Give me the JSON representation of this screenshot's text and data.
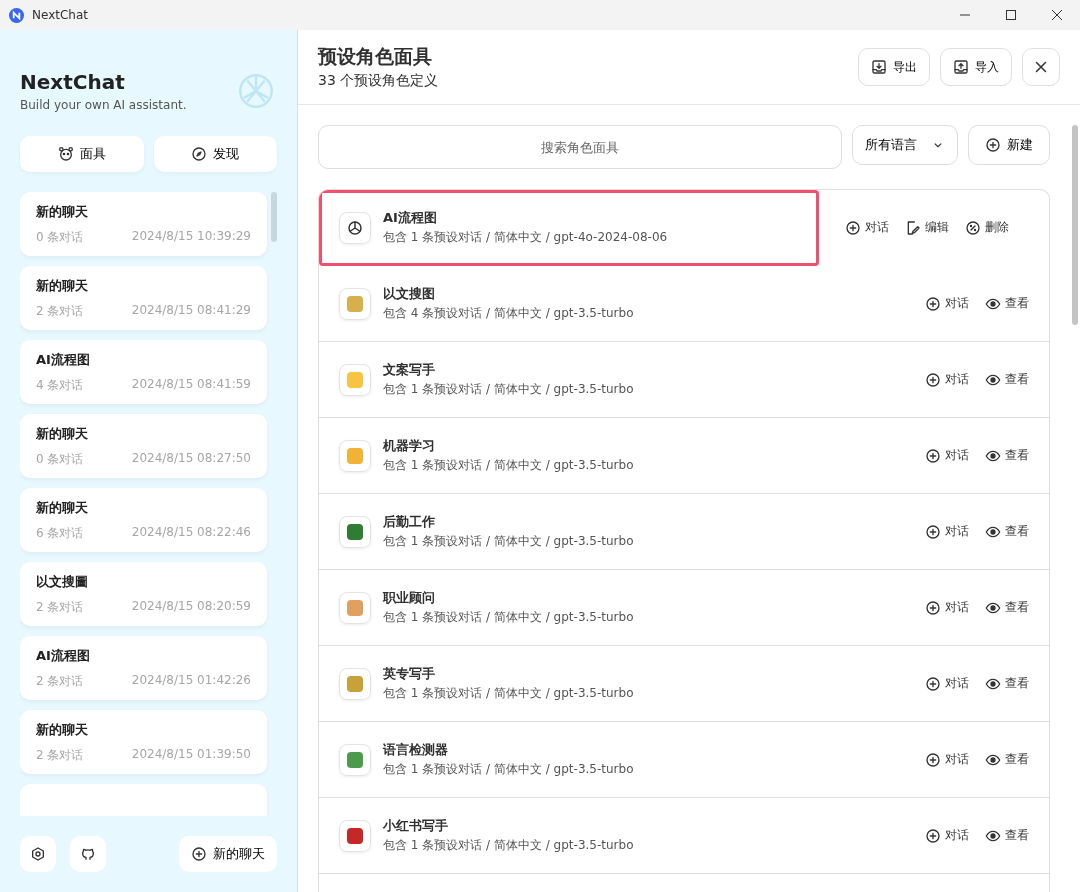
{
  "window": {
    "title": "NextChat"
  },
  "sidebar": {
    "title": "NextChat",
    "subtitle": "Build your own AI assistant.",
    "nav_buttons": [
      {
        "kind": "mask",
        "label": "面具"
      },
      {
        "kind": "discover",
        "label": "发现"
      }
    ],
    "chats": [
      {
        "title": "新的聊天",
        "count": "0 条对话",
        "time": "2024/8/15 10:39:29"
      },
      {
        "title": "新的聊天",
        "count": "2 条对话",
        "time": "2024/8/15 08:41:29"
      },
      {
        "title": "AI流程图",
        "count": "4 条对话",
        "time": "2024/8/15 08:41:59"
      },
      {
        "title": "新的聊天",
        "count": "0 条对话",
        "time": "2024/8/15 08:27:50"
      },
      {
        "title": "新的聊天",
        "count": "6 条对话",
        "time": "2024/8/15 08:22:46"
      },
      {
        "title": "以文搜圖",
        "count": "2 条对话",
        "time": "2024/8/15 08:20:59"
      },
      {
        "title": "AI流程图",
        "count": "2 条对话",
        "time": "2024/8/15 01:42:26"
      },
      {
        "title": "新的聊天",
        "count": "2 条对话",
        "time": "2024/8/15 01:39:50"
      }
    ],
    "new_chat": "新的聊天"
  },
  "header": {
    "title": "预设角色面具",
    "subtitle": "33 个预设角色定义",
    "actions": [
      {
        "kind": "export",
        "label": "导出"
      },
      {
        "kind": "import",
        "label": "导入"
      }
    ]
  },
  "toolbar": {
    "search": {
      "placeholder": "搜索角色面具"
    },
    "language": "所有语言",
    "new_button": "新建"
  },
  "masks": [
    {
      "name": "AI流程图",
      "info": "包含 1 条预设对话 / 简体中文 / gpt-4o-2024-08-06",
      "highlighted": true,
      "actions": [
        {
          "kind": "chat",
          "label": "对话"
        },
        {
          "kind": "edit",
          "label": "编辑"
        },
        {
          "kind": "delete",
          "label": "删除"
        }
      ]
    },
    {
      "name": "以文搜图",
      "info": "包含 4 条预设对话 / 简体中文 / gpt-3.5-turbo",
      "highlighted": false,
      "actions": [
        {
          "kind": "chat",
          "label": "对话"
        },
        {
          "kind": "view",
          "label": "查看"
        }
      ]
    },
    {
      "name": "文案写手",
      "info": "包含 1 条预设对话 / 简体中文 / gpt-3.5-turbo",
      "highlighted": false,
      "actions": [
        {
          "kind": "chat",
          "label": "对话"
        },
        {
          "kind": "view",
          "label": "查看"
        }
      ]
    },
    {
      "name": "机器学习",
      "info": "包含 1 条预设对话 / 简体中文 / gpt-3.5-turbo",
      "highlighted": false,
      "actions": [
        {
          "kind": "chat",
          "label": "对话"
        },
        {
          "kind": "view",
          "label": "查看"
        }
      ]
    },
    {
      "name": "后勤工作",
      "info": "包含 1 条预设对话 / 简体中文 / gpt-3.5-turbo",
      "highlighted": false,
      "actions": [
        {
          "kind": "chat",
          "label": "对话"
        },
        {
          "kind": "view",
          "label": "查看"
        }
      ]
    },
    {
      "name": "职业顾问",
      "info": "包含 1 条预设对话 / 简体中文 / gpt-3.5-turbo",
      "highlighted": false,
      "actions": [
        {
          "kind": "chat",
          "label": "对话"
        },
        {
          "kind": "view",
          "label": "查看"
        }
      ]
    },
    {
      "name": "英专写手",
      "info": "包含 1 条预设对话 / 简体中文 / gpt-3.5-turbo",
      "highlighted": false,
      "actions": [
        {
          "kind": "chat",
          "label": "对话"
        },
        {
          "kind": "view",
          "label": "查看"
        }
      ]
    },
    {
      "name": "语言检测器",
      "info": "包含 1 条预设对话 / 简体中文 / gpt-3.5-turbo",
      "highlighted": false,
      "actions": [
        {
          "kind": "chat",
          "label": "对话"
        },
        {
          "kind": "view",
          "label": "查看"
        }
      ]
    },
    {
      "name": "小红书写手",
      "info": "包含 1 条预设对话 / 简体中文 / gpt-3.5-turbo",
      "highlighted": false,
      "actions": [
        {
          "kind": "chat",
          "label": "对话"
        },
        {
          "kind": "view",
          "label": "查看"
        }
      ]
    }
  ]
}
